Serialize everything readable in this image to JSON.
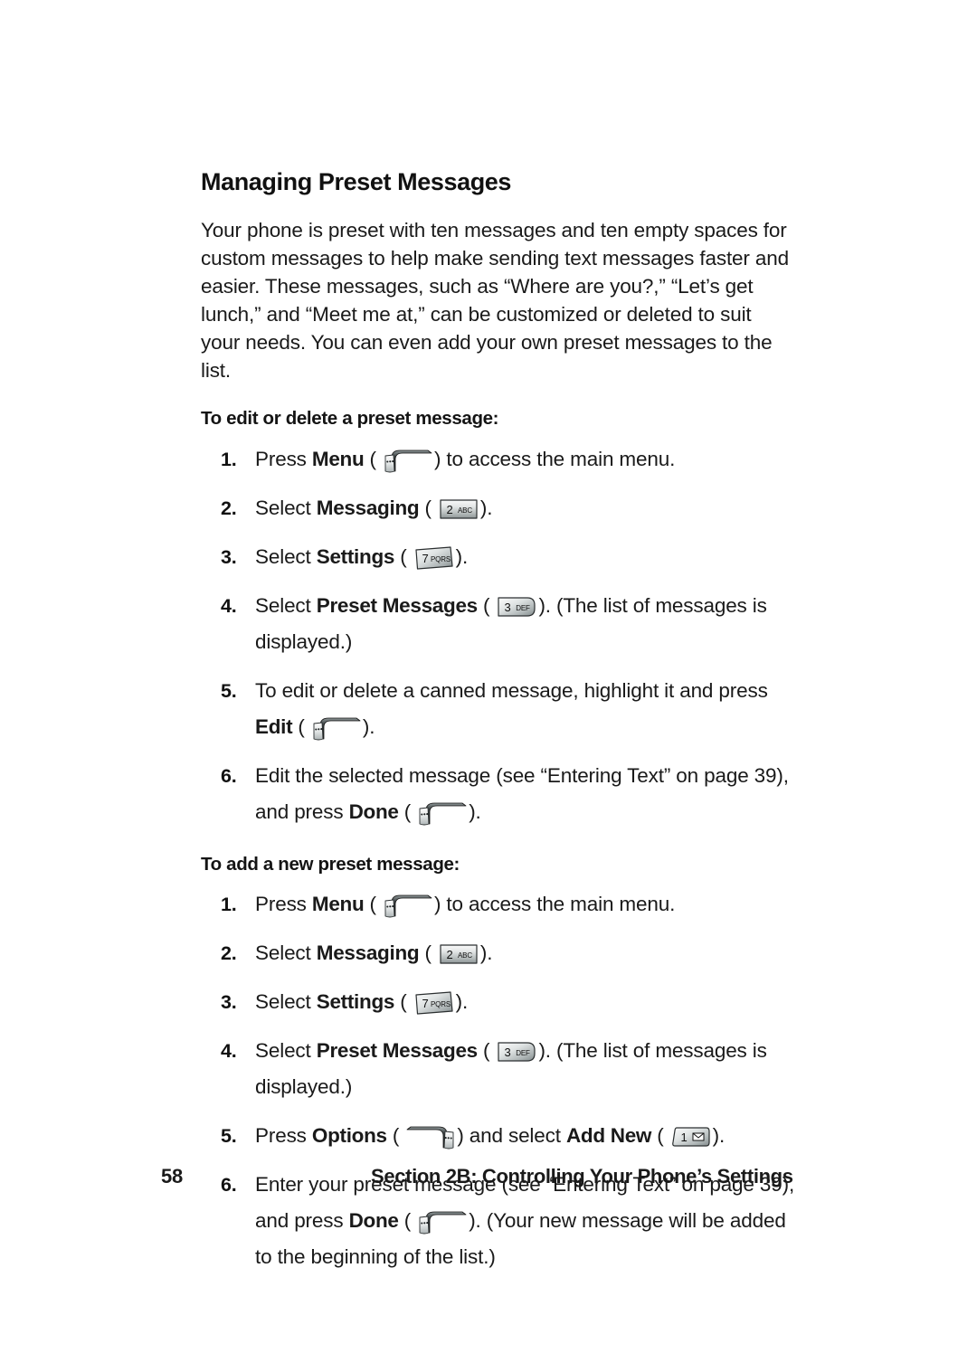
{
  "page": {
    "number": "58",
    "running_head": "Section 2B: Controlling Your Phone’s Settings"
  },
  "heading": "Managing Preset Messages",
  "intro_paragraph": "Your phone is preset with ten messages and ten empty spaces for custom messages to help make sending text messages faster and easier. These messages, such as “Where are you?,” “Let’s get lunch,” and “Meet me at,” can be customized or deleted to suit your needs. You can even add your own preset messages to the list.",
  "sections": [
    {
      "title": "To edit or delete a preset message:",
      "steps": [
        {
          "num": "1.",
          "pre": "Press ",
          "bold": "Menu",
          "mid": " (",
          "icon": "left-softkey-icon",
          "post": ") to access the main menu."
        },
        {
          "num": "2.",
          "pre": "Select ",
          "bold": "Messaging",
          "mid": " (",
          "icon": "key-2-abc-icon",
          "post": ")."
        },
        {
          "num": "3.",
          "pre": "Select ",
          "bold": "Settings",
          "mid": " (",
          "icon": "key-7-pqrs-icon",
          "post": ")."
        },
        {
          "num": "4.",
          "pre": "Select ",
          "bold": "Preset Messages",
          "mid": " (",
          "icon": "key-3-def-icon",
          "post": "). (The list of messages is displayed.)"
        },
        {
          "num": "5.",
          "pre": "To edit or delete a canned message, highlight it and press ",
          "bold": "Edit",
          "mid": " (",
          "icon": "left-softkey-icon",
          "post": ")."
        },
        {
          "num": "6.",
          "pre": "Edit the selected message (see “Entering Text” on page 39), and press ",
          "bold": "Done",
          "mid": " (",
          "icon": "left-softkey-icon",
          "post": ")."
        }
      ]
    },
    {
      "title": "To add a new preset message:",
      "steps": [
        {
          "num": "1.",
          "pre": "Press ",
          "bold": "Menu",
          "mid": " (",
          "icon": "left-softkey-icon",
          "post": ") to access the main menu."
        },
        {
          "num": "2.",
          "pre": "Select ",
          "bold": "Messaging",
          "mid": " (",
          "icon": "key-2-abc-icon",
          "post": ")."
        },
        {
          "num": "3.",
          "pre": "Select ",
          "bold": "Settings",
          "mid": " (",
          "icon": "key-7-pqrs-icon",
          "post": ")."
        },
        {
          "num": "4.",
          "pre": "Select ",
          "bold": "Preset Messages",
          "mid": " (",
          "icon": "key-3-def-icon",
          "post": "). (The list of messages is displayed.)"
        },
        {
          "num": "5.",
          "pre": "Press ",
          "bold": "Options",
          "mid": " (",
          "icon": "right-softkey-icon",
          "post": ") and select ",
          "bold2": "Add New",
          "mid2": " (",
          "icon2": "key-1-envelope-icon",
          "post2": ")."
        },
        {
          "num": "6.",
          "pre": "Enter your preset message (see “Entering Text” on page 39), and press ",
          "bold": "Done",
          "mid": " (",
          "icon": "left-softkey-icon",
          "post": "). (Your new message will be added to the beginning of the list.)"
        }
      ]
    }
  ],
  "key_labels": {
    "key_2": "2",
    "key_2_letters": "ABC",
    "key_7": "7",
    "key_7_letters": "PQRS",
    "key_3": "3",
    "key_3_letters": "DEF",
    "key_1": "1",
    "key_1_symbol": "✉"
  },
  "colors": {
    "text": "#1a1a1a",
    "heading": "#111111",
    "key_light": "#f2f2f2",
    "key_mid": "#b8bcbc",
    "key_dark": "#6d7374",
    "key_outline": "#2b2f30"
  }
}
